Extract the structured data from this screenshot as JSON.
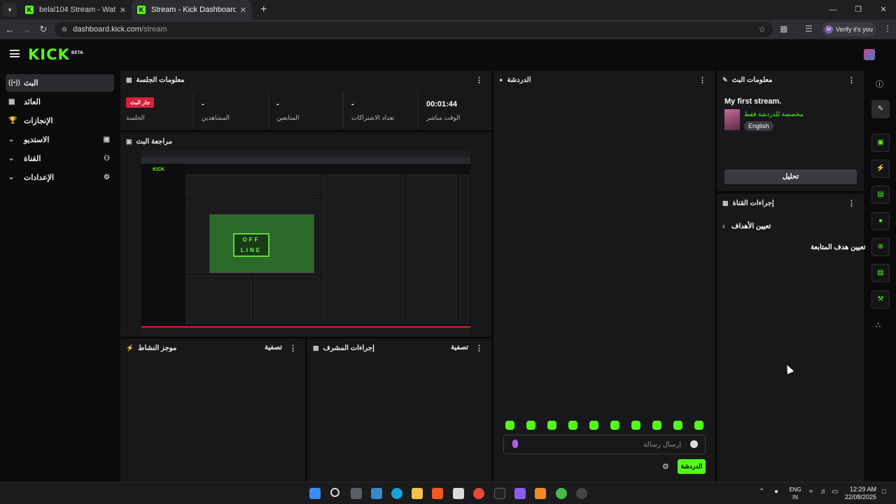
{
  "browser": {
    "tabs": [
      {
        "title": "belal104 Stream - Watch Live o",
        "favicon": "K"
      },
      {
        "title": "Stream - Kick Dashboard",
        "favicon": "K"
      }
    ],
    "url_host": "dashboard.kick.com",
    "url_path": "/stream",
    "profile_label": "Verify it's you",
    "profile_initial": "M"
  },
  "site": {
    "logo": "KICK",
    "logo_badge": "BETA"
  },
  "sidebar": {
    "items": [
      {
        "label": "البث",
        "icon": "broadcast-icon"
      },
      {
        "label": "العائد",
        "icon": "revenue-icon"
      },
      {
        "label": "الإنجازات",
        "icon": "trophy-icon"
      },
      {
        "label": "الاستديو",
        "icon": "studio-icon"
      },
      {
        "label": "القناة",
        "icon": "channel-icon"
      },
      {
        "label": "الإعدادات",
        "icon": "gear-icon"
      }
    ]
  },
  "session": {
    "title": "معلومات الجلسة",
    "live_badge": "جار البث",
    "session_label": "الجلسة",
    "stats": [
      {
        "value": "-",
        "label": "المشاهدين"
      },
      {
        "value": "-",
        "label": "المتابعين"
      },
      {
        "value": "-",
        "label": "تعداد الاشتراكات"
      },
      {
        "value": "00:01:44",
        "label": "الوقت مباشر"
      }
    ]
  },
  "preview": {
    "title": "مراجعة البث",
    "game_sign": "OFF LINE"
  },
  "activity": {
    "title": "موجز النشاط",
    "filter": "تصفية"
  },
  "mod_actions": {
    "title": "إجراءات المشرف",
    "filter": "تصفية"
  },
  "chat": {
    "title": "الدردشة",
    "placeholder": "إرسال رسالة",
    "send_label": "الدردشة"
  },
  "stream_info": {
    "title": "معلومات البث",
    "stream_title": "My first stream.",
    "category": "مخصصة للدردشة فقط",
    "language": "English",
    "edit_label": "تحليل"
  },
  "channel_actions": {
    "title": "إجراءات القناة",
    "goals_header": "تعيين الأهداف",
    "goal_item": "تعيين هدف المتابعة"
  },
  "taskbar": {
    "lang_line1": "ENG",
    "lang_line2": "IN",
    "time": "12:29 AM",
    "date": "22/08/2025"
  },
  "colors": {
    "accent": "#53fc18",
    "live": "#d71f3e",
    "panel": "#18181b"
  }
}
